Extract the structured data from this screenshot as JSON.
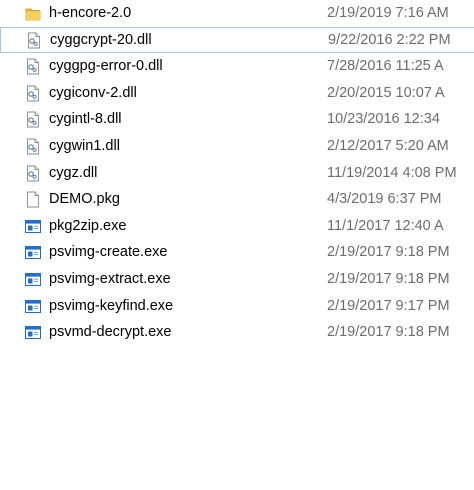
{
  "colors": {
    "folder": "#e8b53a",
    "selection_border": "#9ec7ea",
    "date_text": "#6d6d6d",
    "exe_blue": "#1f6fce"
  },
  "files": [
    {
      "name": "h-encore-2.0",
      "date": "2/19/2019 7:16 AM",
      "type": "folder",
      "icon": "folder-icon"
    },
    {
      "name": "cyggcrypt-20.dll",
      "date": "9/22/2016 2:22 PM",
      "type": "dll",
      "icon": "dll-file-icon",
      "focused": true
    },
    {
      "name": "cyggpg-error-0.dll",
      "date": "7/28/2016 11:25 A",
      "type": "dll",
      "icon": "dll-file-icon"
    },
    {
      "name": "cygiconv-2.dll",
      "date": "2/20/2015 10:07 A",
      "type": "dll",
      "icon": "dll-file-icon"
    },
    {
      "name": "cygintl-8.dll",
      "date": "10/23/2016 12:34",
      "type": "dll",
      "icon": "dll-file-icon"
    },
    {
      "name": "cygwin1.dll",
      "date": "2/12/2017 5:20 AM",
      "type": "dll",
      "icon": "dll-file-icon"
    },
    {
      "name": "cygz.dll",
      "date": "11/19/2014 4:08 PM",
      "type": "dll",
      "icon": "dll-file-icon"
    },
    {
      "name": "DEMO.pkg",
      "date": "4/3/2019 6:37 PM",
      "type": "file",
      "icon": "blank-file-icon"
    },
    {
      "name": "pkg2zip.exe",
      "date": "11/1/2017 12:40 A",
      "type": "exe",
      "icon": "exe-file-icon"
    },
    {
      "name": "psvimg-create.exe",
      "date": "2/19/2017 9:18 PM",
      "type": "exe",
      "icon": "exe-file-icon"
    },
    {
      "name": "psvimg-extract.exe",
      "date": "2/19/2017 9:18 PM",
      "type": "exe",
      "icon": "exe-file-icon"
    },
    {
      "name": "psvimg-keyfind.exe",
      "date": "2/19/2017 9:17 PM",
      "type": "exe",
      "icon": "exe-file-icon"
    },
    {
      "name": "psvmd-decrypt.exe",
      "date": "2/19/2017 9:18 PM",
      "type": "exe",
      "icon": "exe-file-icon"
    }
  ]
}
